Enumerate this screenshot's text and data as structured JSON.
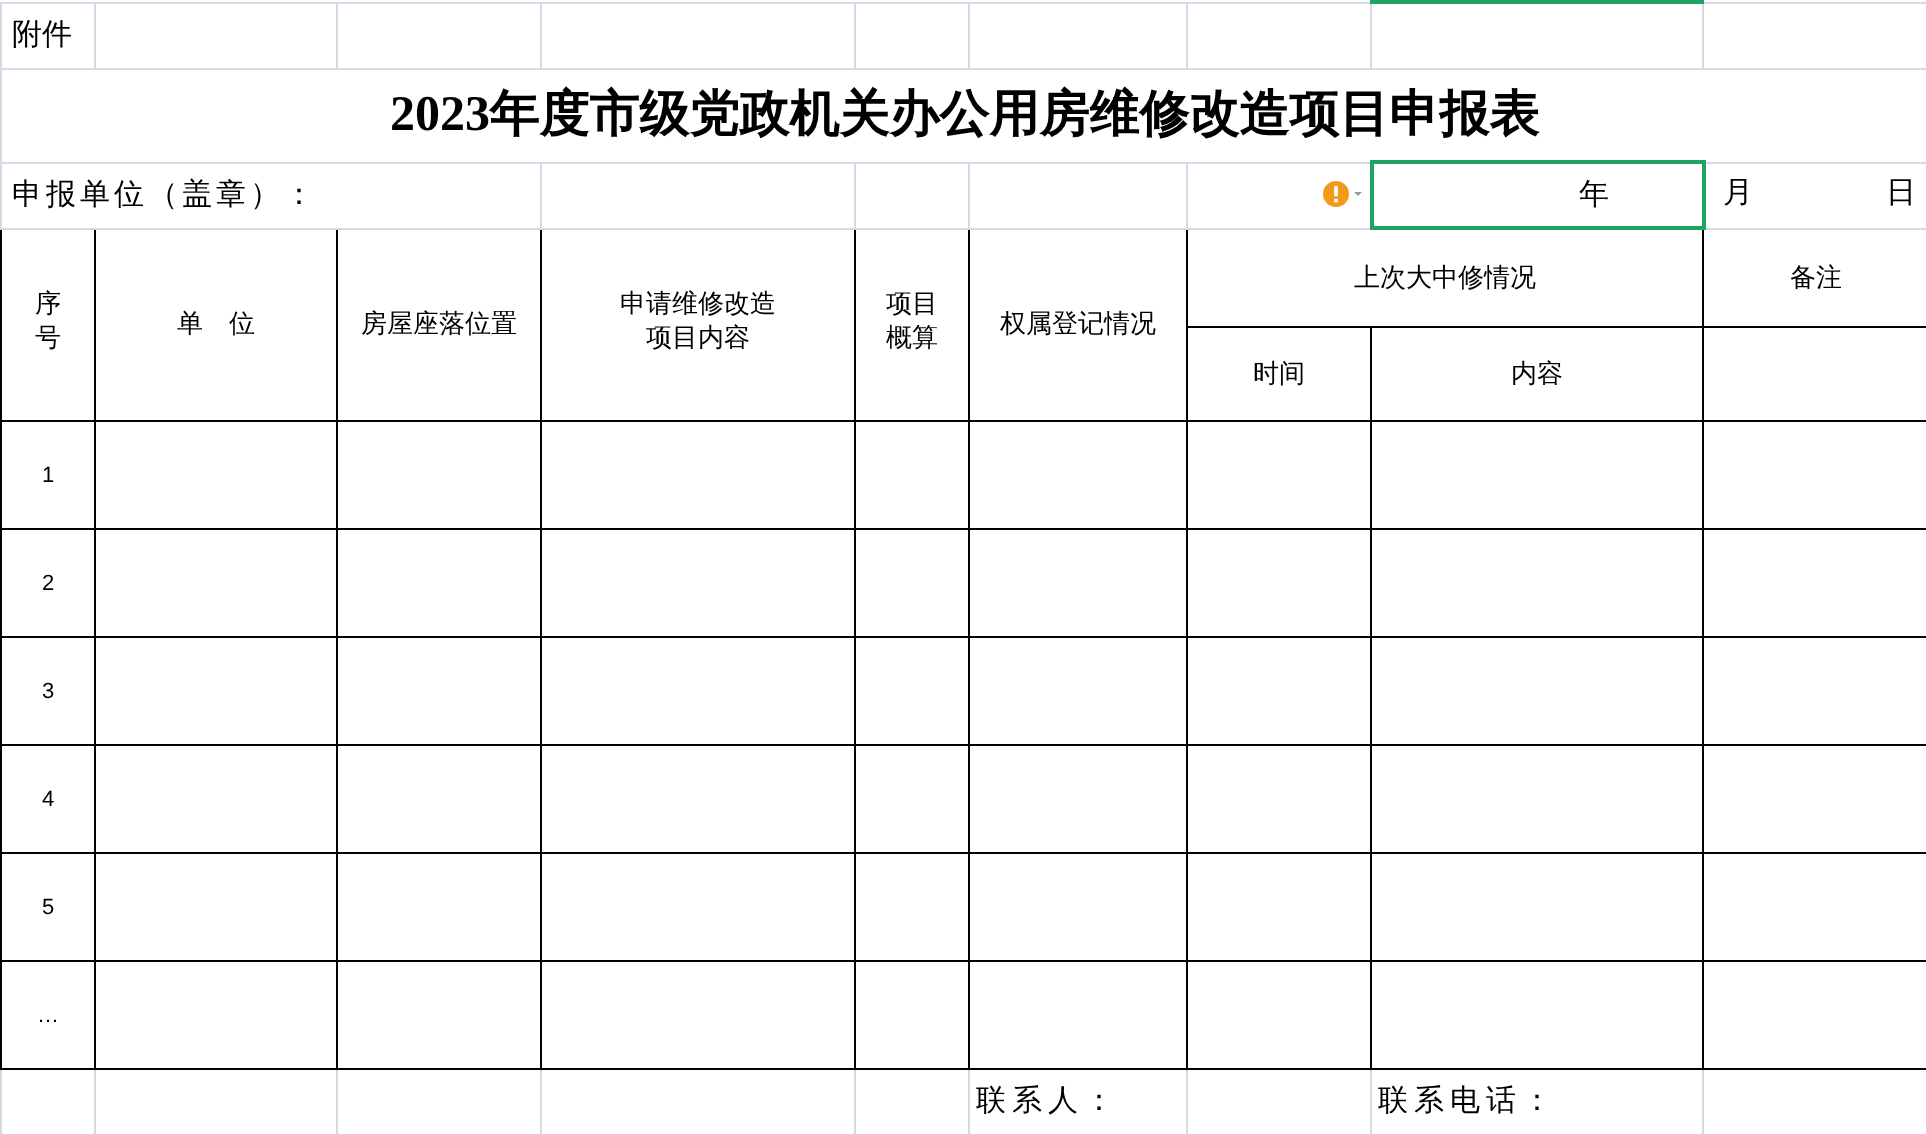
{
  "sheet": {
    "attachment_label": "附件",
    "title": "2023年度市级党政机关办公用房维修改造项目申报表",
    "applicant_label": "申报单位（盖章）：",
    "warning_indicator": true,
    "date": {
      "year": "年",
      "year_selected": true,
      "month": "月",
      "day": "日"
    },
    "table": {
      "headers": [
        "序号",
        "单　位",
        "房屋座落位置",
        "申请维修改造项目内容",
        "项目概算",
        "权属登记情况"
      ],
      "group_header": "上次大中修情况",
      "group_columns": [
        "时间",
        "内容"
      ],
      "remarks_header": "备注",
      "rows": [
        {
          "index": "1"
        },
        {
          "index": "2"
        },
        {
          "index": "3"
        },
        {
          "index": "4"
        },
        {
          "index": "5"
        },
        {
          "index": "…"
        }
      ]
    },
    "footer": {
      "contact_label": "联系人：",
      "phone_label": "联系电话："
    }
  }
}
